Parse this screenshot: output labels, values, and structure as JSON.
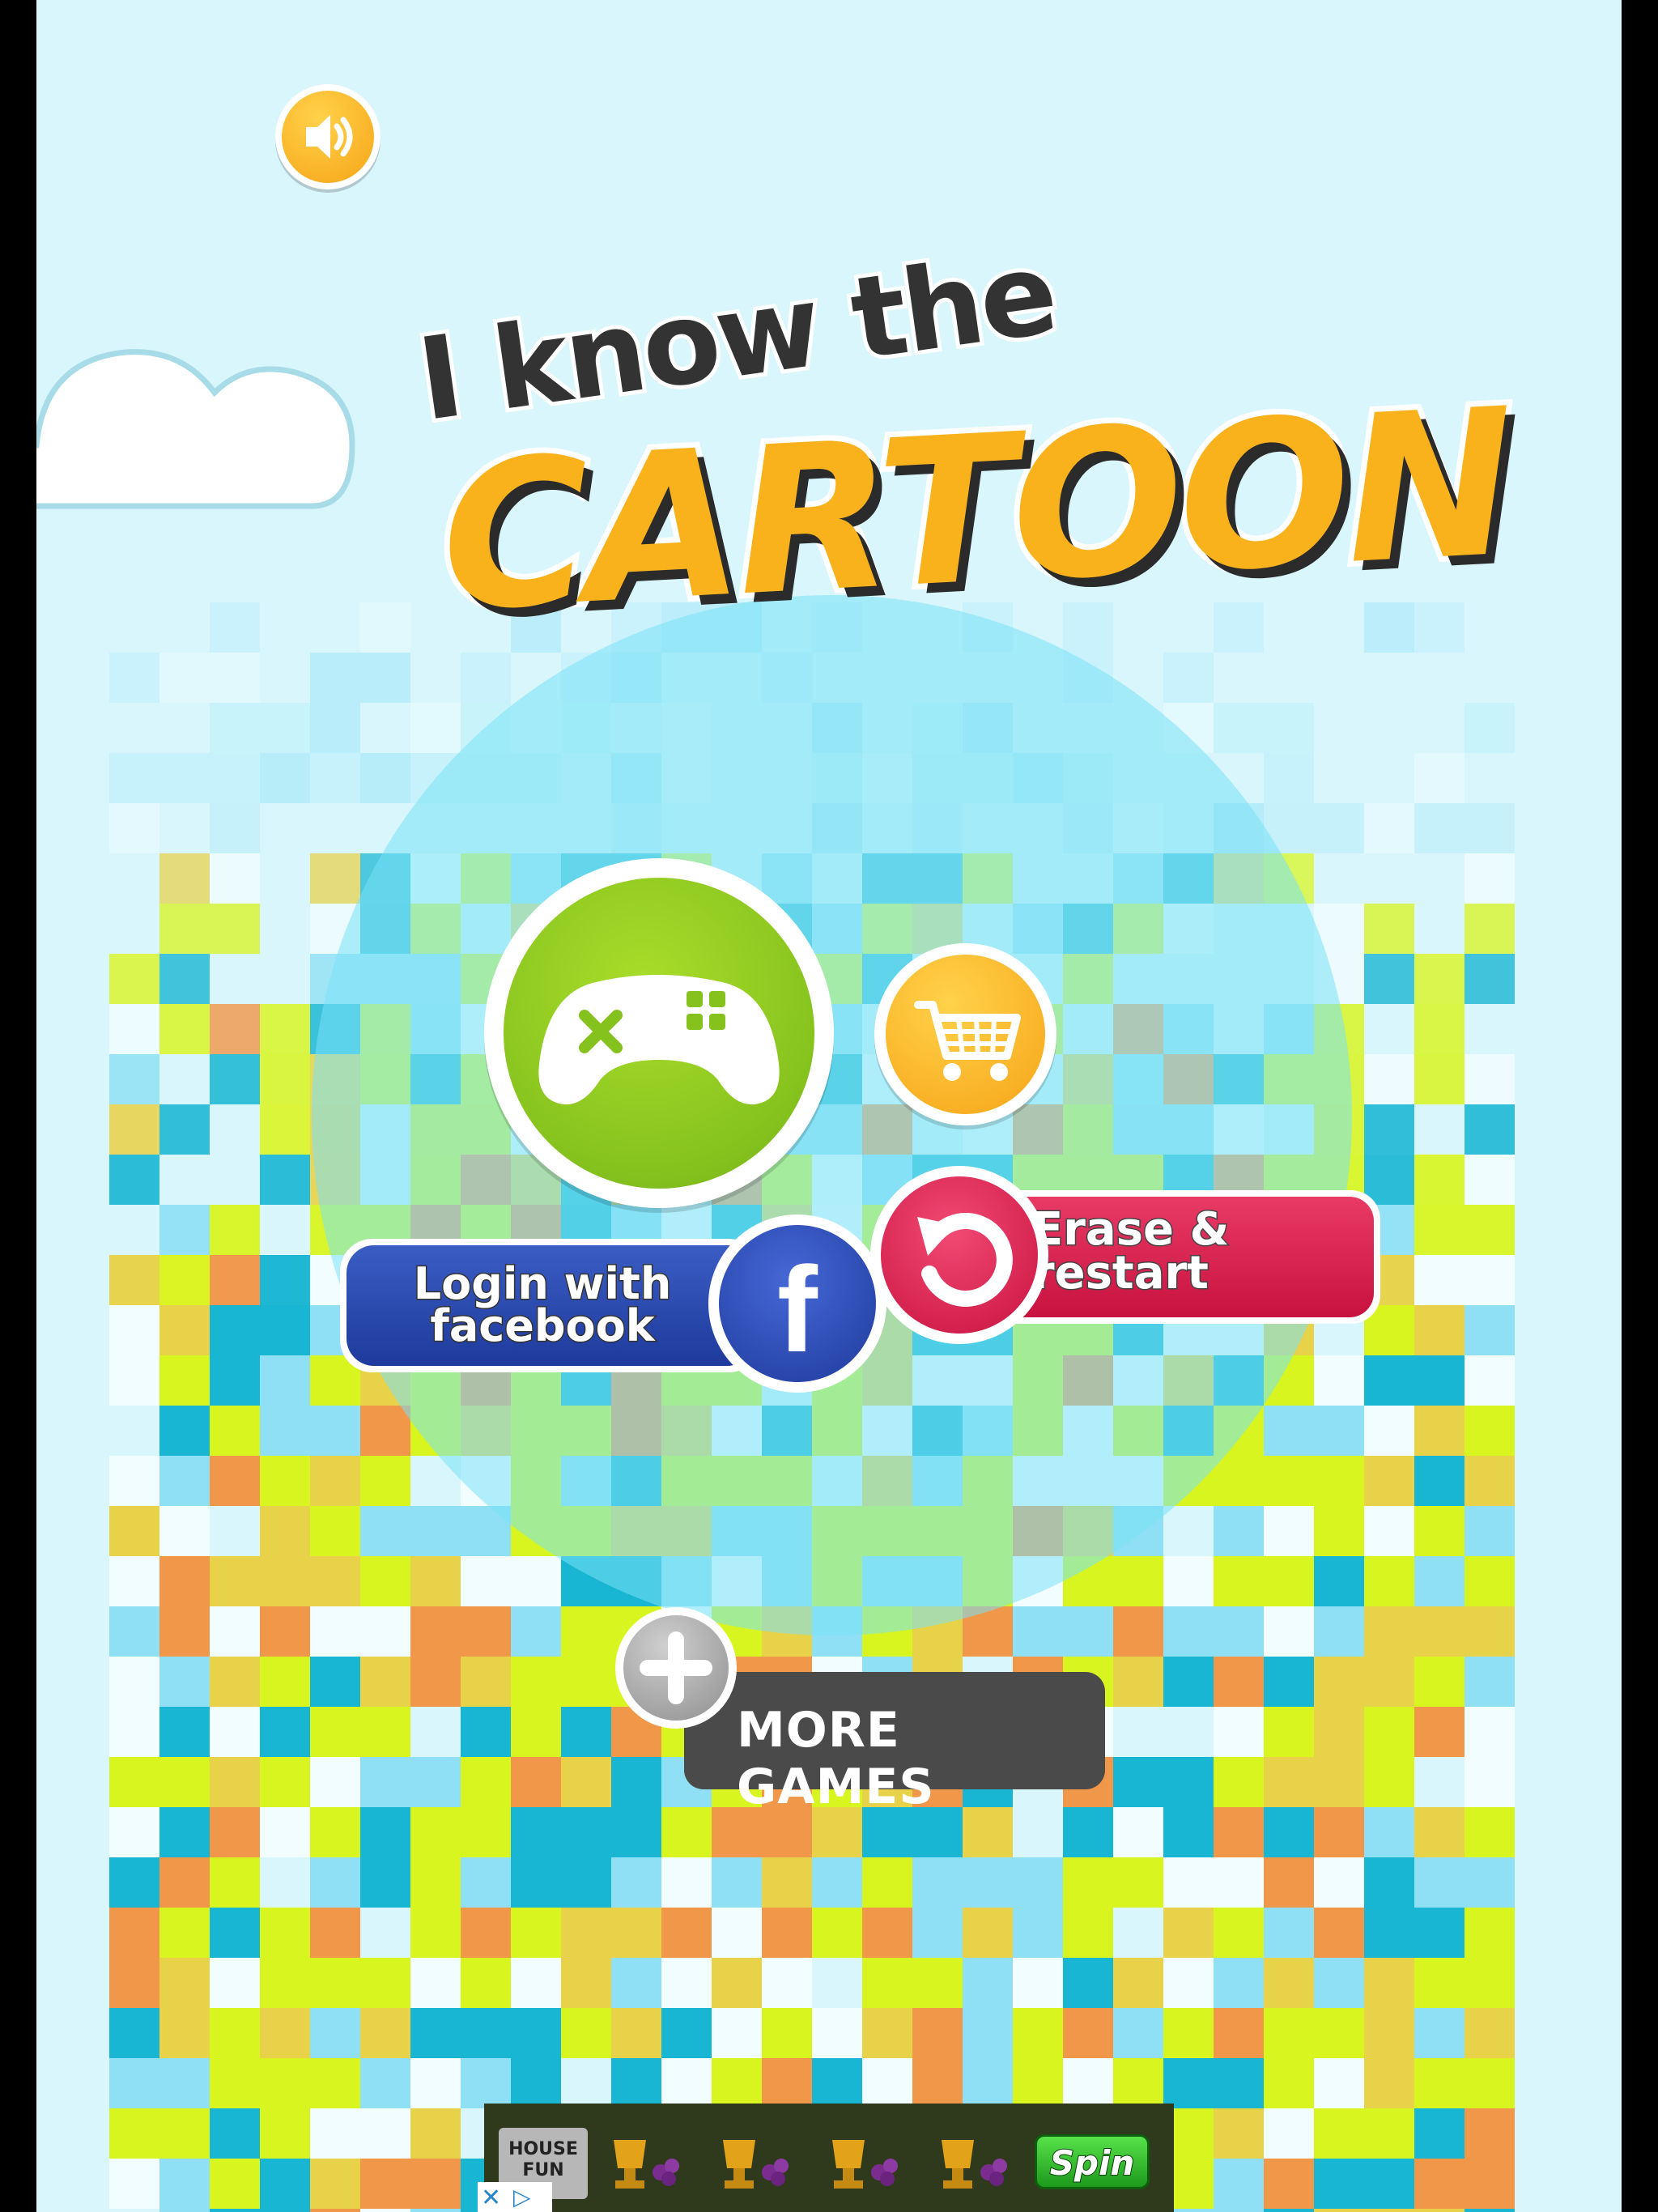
{
  "app": {
    "title_line1": "I know the",
    "title_line2": "CARTOON"
  },
  "buttons": {
    "sound_icon": "speaker-icon",
    "play_icon": "gamepad-icon",
    "shop_icon": "shopping-cart-icon",
    "erase_label": "Erase & restart",
    "erase_icon": "restart-arrow-icon",
    "facebook_label": "Login with facebook",
    "facebook_glyph": "f",
    "more_games_label": "MORE GAMES",
    "more_games_icon": "plus-icon"
  },
  "ad": {
    "brand_text": "HOUSE FUN",
    "cta_label": "Spin",
    "close_glyph": "✕",
    "info_glyph": "▷"
  },
  "colors": {
    "background": "#d8f6fc",
    "play_green": "#86c21e",
    "orange": "#f7a417",
    "erase_red": "#c8123f",
    "facebook_blue": "#1e3a9c",
    "more_games_gray": "#4a4a4a"
  }
}
